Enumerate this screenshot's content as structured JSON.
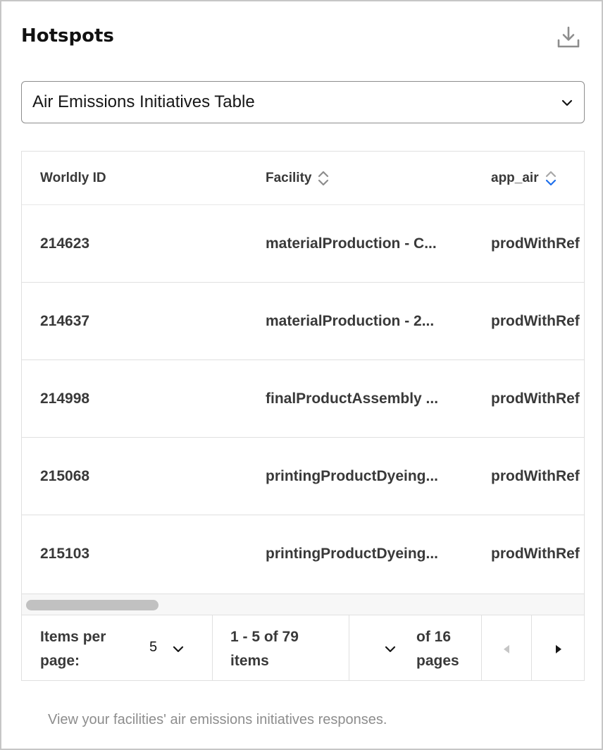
{
  "card": {
    "title": "Hotspots",
    "icons": {
      "download": "download-icon"
    }
  },
  "select": {
    "value": "Air Emissions Initiatives Table",
    "icon": "chevron-down-icon"
  },
  "table": {
    "columns": [
      {
        "label": "Worldly ID",
        "sortable": false
      },
      {
        "label": "Facility",
        "sortable": true,
        "sort_state": "unsorted"
      },
      {
        "label": "app_air",
        "sortable": true,
        "sort_state": "descending"
      }
    ],
    "rows": [
      [
        "214623",
        "materialProduction - C...",
        "prodWithRef"
      ],
      [
        "214637",
        "materialProduction - 2...",
        "prodWithRef"
      ],
      [
        "214998",
        "finalProductAssembly ...",
        "prodWithRef"
      ],
      [
        "215068",
        "printingProductDyeing...",
        "prodWithRef"
      ],
      [
        "215103",
        "printingProductDyeing...",
        "prodWithRef"
      ]
    ],
    "colors": {
      "sort_active": "#1f6feb",
      "sort_inactive": "#8d8d8d"
    }
  },
  "pagination": {
    "items_per_page_label_line1": "Items per",
    "items_per_page_label_line2": "page:",
    "items_per_page_value": "5",
    "range_line1": "1 - 5 of 79",
    "range_line2": "items",
    "of_pages_line1": "of 16",
    "of_pages_line2": "pages",
    "icons": {
      "prev": "caret-left-icon",
      "next": "caret-right-icon",
      "page_select": "chevron-down-icon"
    }
  },
  "footer": {
    "description": "View your facilities' air emissions initiatives responses."
  }
}
